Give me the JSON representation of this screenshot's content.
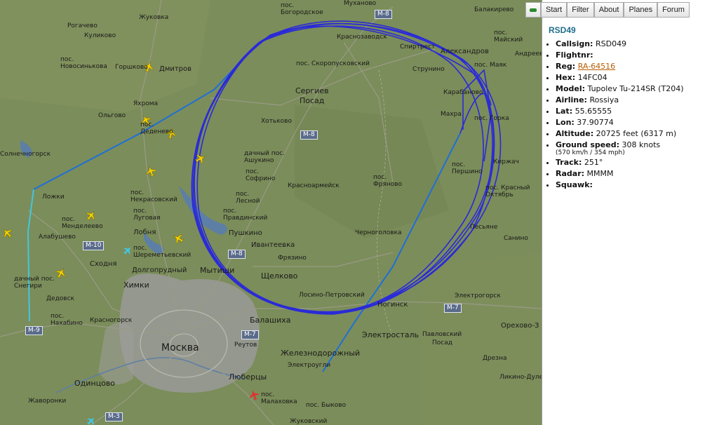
{
  "nav": {
    "start": "Start",
    "filter": "Filter",
    "about": "About",
    "planes": "Planes",
    "forum": "Forum"
  },
  "flight": {
    "title": "RSD49",
    "callsign_label": "Callsign:",
    "callsign": "RSD049",
    "flightnr_label": "Flightnr:",
    "flightnr": "",
    "reg_label": "Reg:",
    "reg": "RA-64516",
    "hex_label": "Hex:",
    "hex": "14FC04",
    "model_label": "Model:",
    "model": "Tupolev Tu-214SR (T204)",
    "airline_label": "Airline:",
    "airline": "Rossiya",
    "lat_label": "Lat:",
    "lat": "55.65555",
    "lon_label": "Lon:",
    "lon": "37.90774",
    "altitude_label": "Altitude:",
    "altitude": "20725 feet (6317 m)",
    "speed_label": "Ground speed:",
    "speed": "308 knots",
    "speed_sub": "(570 km/h / 354 mph)",
    "track_label": "Track:",
    "track": "251°",
    "radar_label": "Radar:",
    "radar": "MMMM",
    "squawk_label": "Squawk:",
    "squawk": ""
  },
  "map": {
    "city": "Москва",
    "towns": {
      "zhukovka": "Жуковка",
      "rogachevo": "Рогачево",
      "kulikovo": "Куликово",
      "dmitrov": "Дмитров",
      "gorshkovo": "Горшково",
      "novosinkovo": "пос. Новосинькова",
      "yakhroma": "Яхрома",
      "olgovo": "Ольгово",
      "dedenevo": "пос. Деденево",
      "solnechnogorsk": "Солнечногорск",
      "lozhki": "Ложки",
      "nekrasovsky": "пос. Некрасовский",
      "mendeleevo": "пос. Менделеево",
      "lugovaya": "пос. Луговая",
      "alabushevo": "Алабушево",
      "lobnya": "Лобня",
      "sheremetyevo": "пос. Шереметьевский",
      "skhodnya": "Сходня",
      "dolgoprudny": "Долгопрудный",
      "snegiri": "дачный пос. Снегири",
      "khimki": "Химки",
      "mytishchi": "Мытищи",
      "dedovsk": "Дедовск",
      "nakhabino": "пос. Нахабино",
      "krasnogorsk": "Красногорск",
      "odintsovo": "Одинцово",
      "zhavoronki": "Жаворонки",
      "bogorodskoe": "пос. Богородское",
      "mukhanovo": "Муханово",
      "balakirevo": "Балакирево",
      "krasnozavodsk": "Краснозаводск",
      "skoropusk": "пос. Скоропуcковский",
      "sergiev": "Сергиев",
      "posad": "Посад",
      "khotkovo": "Хотьково",
      "ashukino": "дачный пос. Ашукино",
      "sofrino": "пос. Софрино",
      "krasnoarmeysk": "Красноармейск",
      "fryanovo": "пос. Фряново",
      "lesnoy": "пос. Лесной",
      "pravdinsky": "пос. Правдинский",
      "pushkino": "Пушкино",
      "ivanteevka": "Ивантеевка",
      "fryazino": "Фрязино",
      "chernogolovka": "Черноголовка",
      "shchelkovo": "Щелково",
      "losino": "Лосино-Петровский",
      "noginsk": "Ногинск",
      "balashikha": "Балашиха",
      "reutov": "Реутов",
      "elektrostal": "Электросталь",
      "pavlovsky": "Павловский",
      "pavlposad": "Посад",
      "zheleznodorozhny": "Железнодорожный",
      "elektrougli": "Электроугли",
      "lyubertsy": "Люберцы",
      "malakhovka": "пос. Малаховка",
      "bykovo": "пос. Быково",
      "zhukovsky": "Жуковский",
      "strunino": "Струнино",
      "aleksandrov": "Александров",
      "spirtrest": "Спиртрест",
      "mayskiy": "пос. Майский",
      "andreevka": "Андреевка",
      "mayak": "пос. Маяк",
      "karabanovo": "Карабаново",
      "makhra": "Махра",
      "gorka": "пос. Горка",
      "pershino": "пос. Першино",
      "kirzhach": "Киржач",
      "krasny_oktyabr": "пос. Красный Октябрь",
      "pesyane": "Песьяне",
      "sanino": "Санино",
      "elektrogorsk": "Электрогорск",
      "orekhovo": "Орехово-З",
      "dresna": "Дрезна",
      "likino": "Ликино-Дулево"
    },
    "roads": {
      "m8a": "M-8",
      "m8b": "M-8",
      "m8c": "M-8",
      "m10": "M-10",
      "m9": "M-9",
      "m7a": "M-7",
      "m7b": "M-7",
      "m3": "M-3"
    },
    "colors": {
      "track": "#1a1ad6",
      "trail": "#1e6fd9",
      "trail_old": "#43c6e0",
      "plane": "#f4d000",
      "selected": "#e23030"
    }
  }
}
